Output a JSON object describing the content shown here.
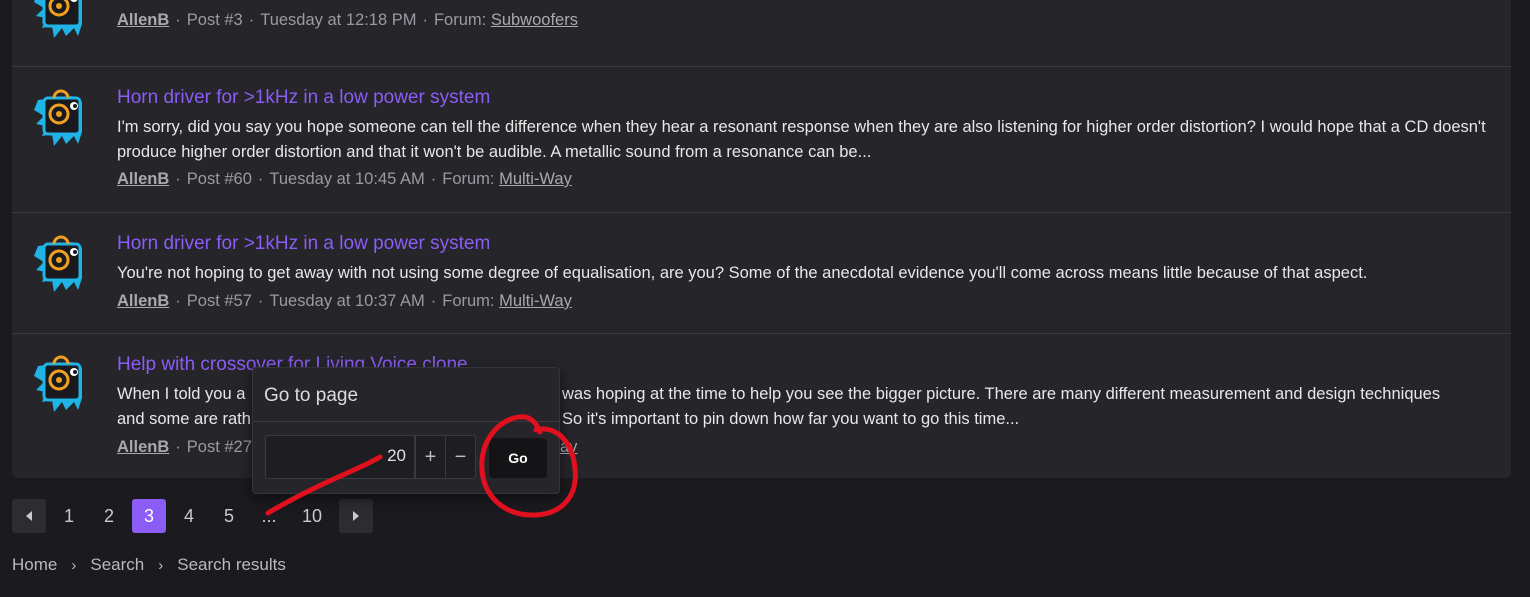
{
  "posts": [
    {
      "title": "",
      "snippet": "",
      "user": "AllenB",
      "post_no": "Post #3",
      "date": "Tuesday at 12:18 PM",
      "forum_label": "Forum:",
      "forum": "Subwoofers"
    },
    {
      "title": "Horn driver for >1kHz in a low power system",
      "snippet": "I'm sorry, did you say you hope someone can tell the difference when they hear a resonant response when they are also listening for higher order distortion? I would hope that a CD doesn't produce higher order distortion and that it won't be audible. A metallic sound from a resonance can be...",
      "user": "AllenB",
      "post_no": "Post #60",
      "date": "Tuesday at 10:45 AM",
      "forum_label": "Forum:",
      "forum": "Multi-Way"
    },
    {
      "title": "Horn driver for >1kHz in a low power system",
      "snippet": "You're not hoping to get away with not using some degree of equalisation, are you? Some of the anecdotal evidence you'll come across means little because of that aspect.",
      "user": "AllenB",
      "post_no": "Post #57",
      "date": "Tuesday at 10:37 AM",
      "forum_label": "Forum:",
      "forum": "Multi-Way"
    },
    {
      "title": "Help with crossover for Living Voice clone",
      "snippet": "When I told you a ... was hoping at the time to help you see the bigger picture. There are many different measurement and design techniques and some are rath... So it's important to pin down how far you want to go this time...",
      "snippet_left": "When I told you a",
      "snippet_right": "was hoping at the time to help you see the bigger picture. There are many different measurement and design techniques",
      "snippet_left2": "and some are rath",
      "snippet_right2": "So it's important to pin down how far you want to go this time...",
      "user": "AllenB",
      "post_no": "Post #27",
      "forum_tail": "ay"
    }
  ],
  "pagination": {
    "prev_icon": "chevron-left-icon",
    "pages": [
      "1",
      "2",
      "3",
      "4",
      "5"
    ],
    "current": "3",
    "ellipsis": "...",
    "last": "10",
    "next_icon": "chevron-right-icon"
  },
  "breadcrumb": [
    "Home",
    "Search",
    "Search results"
  ],
  "goto_popup": {
    "title": "Go to page",
    "value": "20",
    "plus": "+",
    "minus": "−",
    "go_label": "Go"
  },
  "colors": {
    "accent": "#8b5cf6",
    "annotation": "#e0101e",
    "avatar_blue": "#1fb3e6",
    "avatar_orange": "#f0a020"
  }
}
